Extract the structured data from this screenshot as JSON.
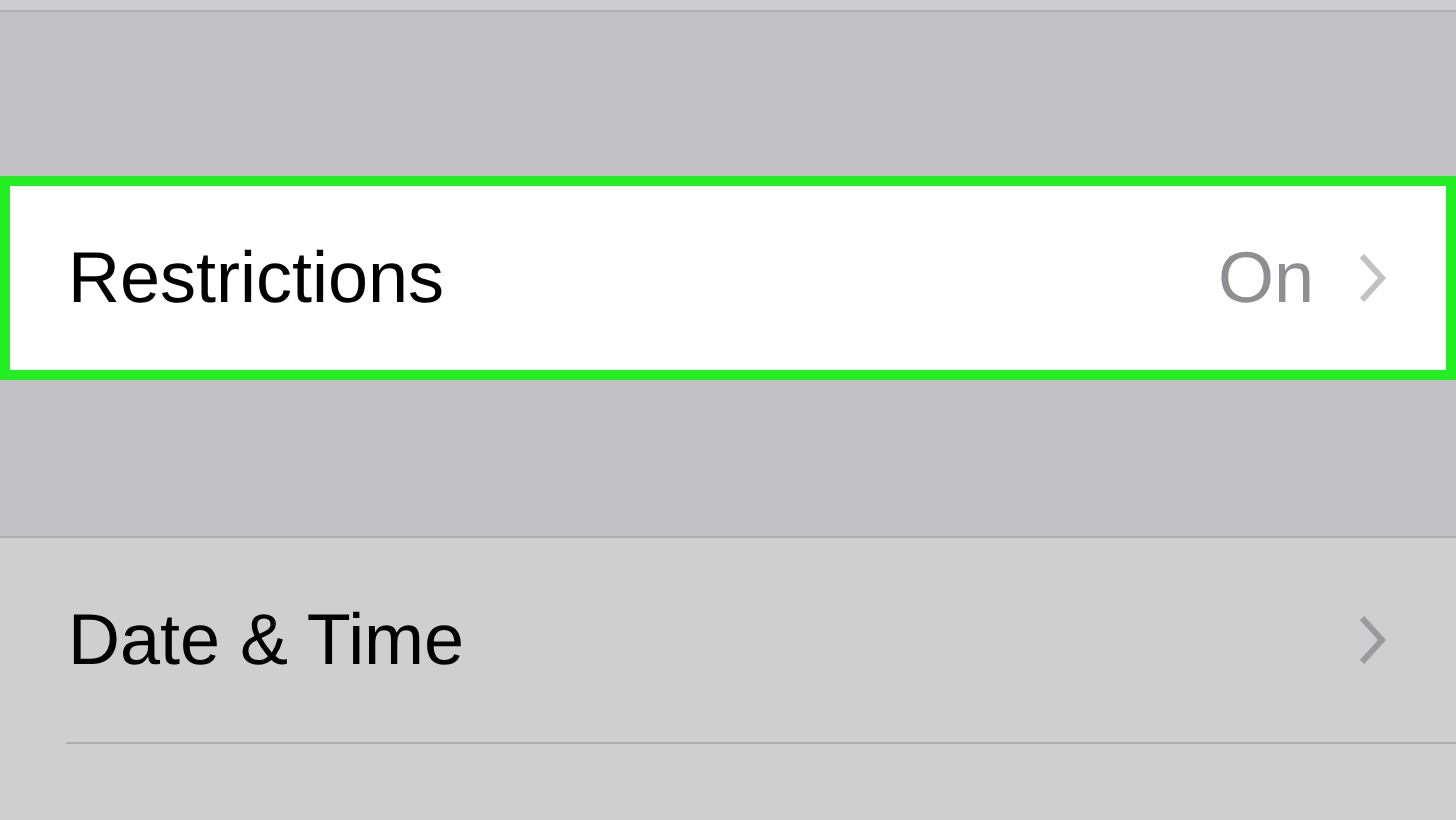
{
  "groups": [
    {
      "dimmed": false,
      "rows": [
        {
          "label": "Restrictions",
          "value": "On",
          "highlighted": true
        }
      ]
    },
    {
      "dimmed": true,
      "rows": [
        {
          "label": "Date & Time",
          "highlighted": false
        }
      ]
    }
  ]
}
